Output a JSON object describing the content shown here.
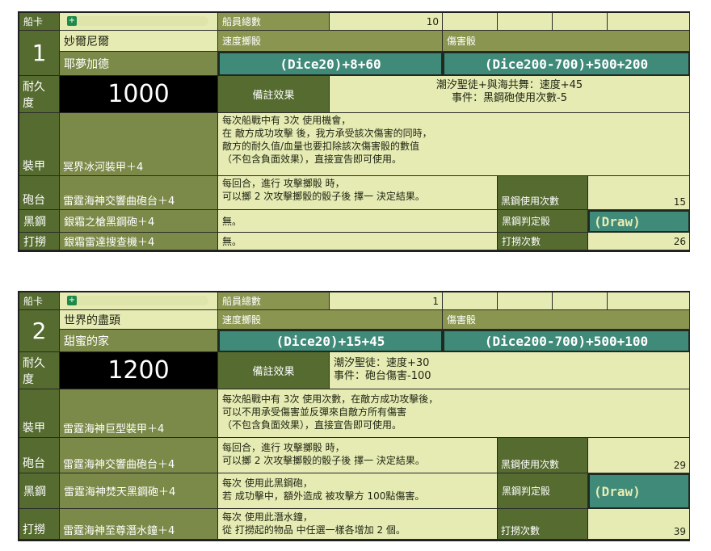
{
  "cards": [
    {
      "ship_label": "船卡",
      "crew_label": "船員總數",
      "crew_count": "10",
      "number": "1",
      "ship_name": "妙爾尼爾",
      "ship_sub": "耶夢加德",
      "speed_label": "速度擲骰",
      "damage_label": "傷害骰",
      "speed_formula": "(Dice20)+8+60",
      "damage_formula": "(Dice200-700)+500+200",
      "durability_label": "耐久度",
      "durability": "1000",
      "remark_label": "備註效果",
      "remark_lines": [
        "潮汐聖徒+與海共舞：速度+45",
        "事件：黑鋼砲使用次數-5"
      ],
      "armor_label": "裝甲",
      "armor_item": "冥界冰河裝甲＋4",
      "armor_note": [
        "每次船戰中有 3次 使用機會，",
        "在 敵方成功攻擊 後，我方承受該次傷害的同時，",
        "敵方的耐久值/血量也要扣除該次傷害骰的數值",
        "（不包含負面效果），直接宣告即可使用。"
      ],
      "turret_label": "砲台",
      "turret_item": "雷霆海神交響曲砲台＋4",
      "turret_note": [
        "每回合，進行 攻擊擲骰 時，",
        "可以擲 2 次攻擊擲骰的骰子後 擇一 決定結果。"
      ],
      "steel_uses_label": "黑鋼使用次數",
      "steel_uses": "15",
      "steel_label": "黑鋼",
      "steel_item": "銀霜之槍黑鋼砲＋4",
      "steel_note": [
        "無。"
      ],
      "steel_judge_label": "黑鋼判定骰",
      "steel_judge": "(Draw)",
      "salvage_label": "打撈",
      "salvage_item": "銀霜雷達搜查機＋4",
      "salvage_note": [
        "無。"
      ],
      "salvage_count_label": "打撈次數",
      "salvage_count": "26"
    },
    {
      "ship_label": "船卡",
      "crew_label": "船員總數",
      "crew_count": "1",
      "number": "2",
      "ship_name": "世界的盡頭",
      "ship_sub": "甜蜜的家",
      "speed_label": "速度擲骰",
      "damage_label": "傷害骰",
      "speed_formula": "(Dice20)+15+45",
      "damage_formula": "(Dice200-700)+500+100",
      "durability_label": "耐久度",
      "durability": "1200",
      "remark_label": "備註效果",
      "remark_lines": [
        "潮汐聖徒：速度+30",
        "事件：砲台傷害-100"
      ],
      "armor_label": "裝甲",
      "armor_item": "雷霆海神巨型裝甲＋4",
      "armor_note": [
        "每次船戰中有 3次 使用次數，在敵方成功攻擊後，",
        "可以不用承受傷害並反彈來自敵方所有傷害",
        "（不包含負面效果），直接宣告即可使用。"
      ],
      "turret_label": "砲台",
      "turret_item": "雷霆海神交響曲砲台＋4",
      "turret_note": [
        "每回合，進行 攻擊擲骰 時，",
        "可以擲 2 次攻擊擲骰的骰子後 擇一 決定結果。"
      ],
      "steel_uses_label": "黑鋼使用次數",
      "steel_uses": "29",
      "steel_label": "黑鋼",
      "steel_item": "雷霆海神焚天黑鋼砲＋4",
      "steel_note": [
        "每次 使用此黑鋼砲，",
        "若 成功擊中，額外造成 被攻擊方 100點傷害。"
      ],
      "steel_judge_label": "黑鋼判定骰",
      "steel_judge": "(Draw)",
      "salvage_label": "打撈",
      "salvage_item": "雷霆海神至尊潛水鐘＋4",
      "salvage_note": [
        "每次 使用此潛水鐘，",
        "從 打撈起的物品 中任選一樣各增加 2 個。"
      ],
      "salvage_count_label": "打撈次數",
      "salvage_count": "39"
    }
  ]
}
